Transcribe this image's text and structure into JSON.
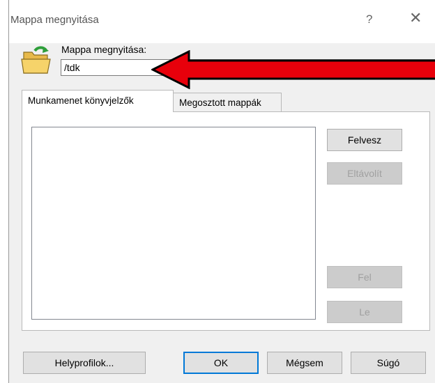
{
  "window": {
    "title": "Mappa megnyitása",
    "help_glyph": "?",
    "close_glyph": "✕"
  },
  "directory": {
    "label": "Mappa megnyitása:",
    "value": "/tdk"
  },
  "tabs": [
    {
      "label": "Munkamenet könyvjelzők",
      "active": true
    },
    {
      "label": "Megosztott mappák",
      "active": false
    }
  ],
  "side_buttons": {
    "add": "Felvesz",
    "remove": "Eltávolít",
    "up": "Fel",
    "down": "Le"
  },
  "bottom_buttons": {
    "profiles": "Helyprofilok...",
    "ok": "OK",
    "cancel": "Mégsem",
    "help": "Súgó"
  },
  "colors": {
    "arrow_fill": "#e8000b",
    "arrow_stroke": "#000000",
    "default_button_border": "#0078d7",
    "folder_yellow": "#f6d36a"
  },
  "icons": {
    "folder": "folder-open-icon",
    "arrow": "red-arrow-pointer"
  }
}
